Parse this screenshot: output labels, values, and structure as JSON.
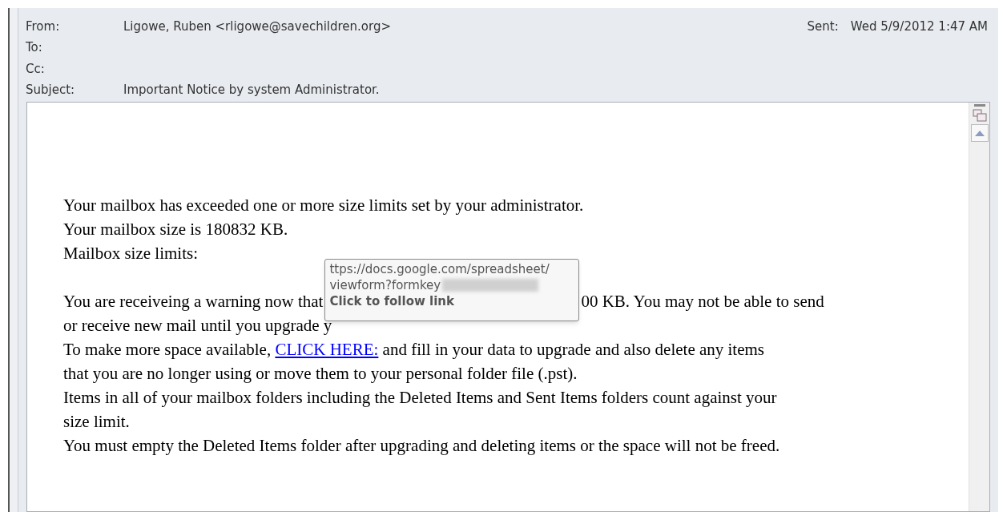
{
  "header": {
    "fields": [
      {
        "label": "From:",
        "value": "Ligowe, Ruben <rligowe@savechildren.org>"
      },
      {
        "label": "To:"
      },
      {
        "label": "Cc:"
      },
      {
        "label": "Subject:",
        "value": "Important Notice by system Administrator."
      }
    ],
    "sent": {
      "label": "Sent:",
      "value": "Wed 5/9/2012 1:47 AM"
    }
  },
  "body": {
    "lines": [
      {
        "kind": "text",
        "text": "Your mailbox has exceeded one or more size limits set by your administrator."
      },
      {
        "kind": "text",
        "text": "Your mailbox size is 180832 KB."
      },
      {
        "kind": "text",
        "text": "Mailbox size limits:"
      },
      {
        "kind": "blank"
      },
      {
        "kind": "covered",
        "before": "You are receiveing a warning now that",
        "after": "00 KB. You may not be able to send"
      },
      {
        "kind": "text",
        "text": "or receive new mail until you upgrade y"
      },
      {
        "kind": "link",
        "before": "To make more space available, ",
        "link": "CLICK HERE:",
        "after": " and fill in your data to upgrade and also delete any items"
      },
      {
        "kind": "text",
        "text": "that you are no longer using or move them to your personal folder file (.pst)."
      },
      {
        "kind": "text",
        "text": "Items in all of your mailbox folders including the Deleted Items and Sent Items folders count against your"
      },
      {
        "kind": "text",
        "text": "size limit."
      },
      {
        "kind": "text",
        "text": "You must empty the Deleted Items folder after upgrading and deleting items or the space will not be freed."
      }
    ]
  },
  "tooltip": {
    "url_lines": [
      "ttps://docs.google.com/spreadsheet/",
      "viewform?formkey"
    ],
    "hint": "Click to follow link"
  }
}
